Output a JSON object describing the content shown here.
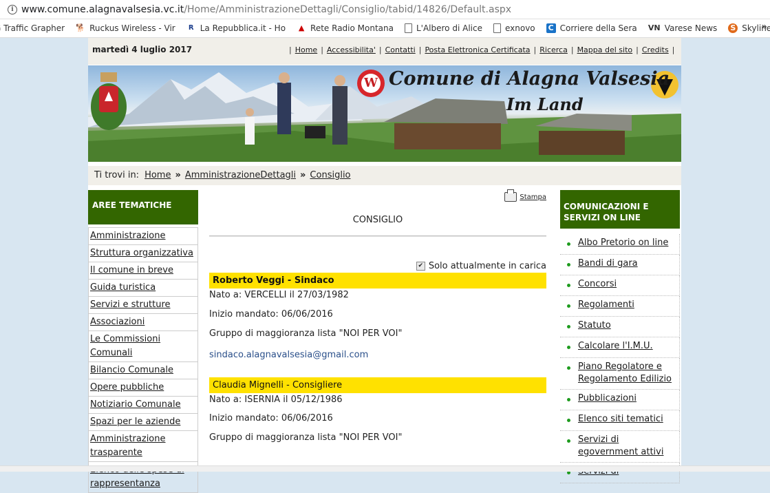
{
  "browser": {
    "url_host": "www.comune.alagnavalsesia.vc.it",
    "url_path": "/Home/AmministrazioneDettagli/Consiglio/tabid/14826/Default.aspx",
    "bookmarks": [
      {
        "label": "G Traffic Grapher",
        "icon": "graph-icon"
      },
      {
        "label": "Ruckus Wireless - Vir",
        "icon": "ruckus-icon"
      },
      {
        "label": "La Repubblica.it - Ho",
        "icon": "repubblica-icon"
      },
      {
        "label": "Rete Radio Montana",
        "icon": "radio-icon"
      },
      {
        "label": "L'Albero di Alice",
        "icon": "page-icon"
      },
      {
        "label": "exnovo",
        "icon": "page-icon"
      },
      {
        "label": "Corriere della Sera",
        "icon": "corriere-icon"
      },
      {
        "label": "Varese News",
        "icon": "varesenews-icon"
      },
      {
        "label": "Skyline",
        "icon": "skyline-icon"
      }
    ],
    "more": "»"
  },
  "topbar": {
    "date": "martedì 4 luglio 2017",
    "links": [
      "Home",
      "Accessibilita'",
      "Contatti",
      "Posta Elettronica Certificata",
      "Ricerca",
      "Mappa del sito",
      "Credits"
    ]
  },
  "banner": {
    "title": "Comune di Alagna Valsesia",
    "subtitle": "Im Land",
    "logo_letter": "W"
  },
  "breadcrumb": {
    "label": "Ti trovi in:",
    "items": [
      "Home",
      "AmministrazioneDettagli",
      "Consiglio"
    ],
    "separator": "»"
  },
  "left": {
    "header": "AREE TEMATICHE",
    "items": [
      "Amministrazione",
      "Struttura organizzativa",
      "Il comune in breve",
      "Guida turistica",
      "Servizi e strutture",
      "Associazioni",
      "Le Commissioni Comunali",
      "Bilancio Comunale",
      "Opere pubbliche",
      "Notiziario Comunale",
      "Spazi per le aziende",
      "Amministrazione trasparente",
      "Elenco delle spese di rappresentanza"
    ]
  },
  "center": {
    "print_label": "Stampa",
    "title": "CONSIGLIO",
    "filter_label": "Solo attualmente in carica",
    "filter_checked": true,
    "members": [
      {
        "name": "Roberto Veggi - Sindaco",
        "born": "Nato a: VERCELLI il 27/03/1982",
        "start": "Inizio mandato: 06/06/2016",
        "group": "Gruppo di maggioranza lista \"NOI PER VOI\"",
        "email": "sindaco.alagnavalsesia@gmail.com"
      },
      {
        "name": "Claudia Mignelli - Consigliere",
        "born": "Nato a: ISERNIA il 05/12/1986",
        "start": "Inizio mandato: 06/06/2016",
        "group": "Gruppo di maggioranza lista \"NOI PER VOI\""
      }
    ]
  },
  "right": {
    "header": "COMUNICAZIONI E SERVIZI ON LINE",
    "items": [
      "Albo Pretorio on line",
      "Bandi di gara",
      "Concorsi",
      "Regolamenti",
      "Statuto",
      "Calcolare l'I.M.U.",
      "Piano Regolatore e Regolamento Edilizio",
      "Pubblicazioni",
      "Elenco siti tematici",
      "Servizi di egovernment attivi",
      "Servizi di"
    ]
  },
  "colors": {
    "green_header": "#336600",
    "member_highlight": "#ffe100",
    "bullet": "#1e9b1e",
    "page_bg": "#d8e6f1"
  }
}
